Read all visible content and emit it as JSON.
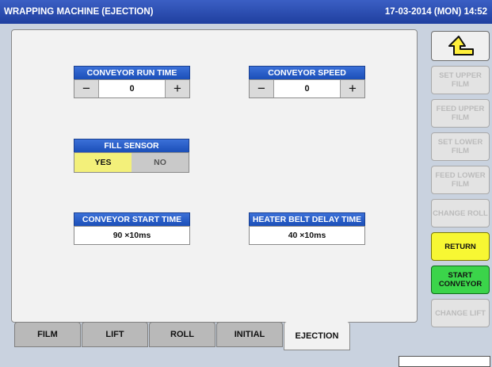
{
  "header": {
    "title": "WRAPPING MACHINE (EJECTION)",
    "datetime": "17-03-2014 (MON) 14:52"
  },
  "widgets": {
    "conveyor_run_time": {
      "label": "CONVEYOR RUN TIME",
      "value": "0",
      "minus": "−",
      "plus": "+"
    },
    "conveyor_speed": {
      "label": "CONVEYOR SPEED",
      "value": "0",
      "minus": "−",
      "plus": "+"
    },
    "fill_sensor": {
      "label": "FILL SENSOR",
      "yes": "YES",
      "no": "NO",
      "selected": "YES"
    },
    "conveyor_start_time": {
      "label": "CONVEYOR START TIME",
      "value": "90 ×10ms"
    },
    "heater_belt_delay_time": {
      "label": "HEATER BELT DELAY TIME",
      "value": "40 ×10ms"
    }
  },
  "tabs": [
    "FILM",
    "LIFT",
    "ROLL",
    "INITIAL",
    "EJECTION"
  ],
  "active_tab": "EJECTION",
  "sidebar": {
    "back_icon": "return-arrow-icon",
    "set_upper_film": "SET UPPER FILM",
    "feed_upper_film": "FEED UPPER FILM",
    "set_lower_film": "SET LOWER FILM",
    "feed_lower_film": "FEED LOWER FILM",
    "change_roll": "CHANGE ROLL",
    "return": "RETURN",
    "start_conveyor": "START CONVEYOR",
    "change_lift": "CHANGE LIFT"
  },
  "colors": {
    "title_bar": "#2a4fb5",
    "widget_header": "#2a5fc8",
    "return_button": "#f7f733",
    "start_conveyor_button": "#3bd44a",
    "selected_toggle": "#f3f07a"
  }
}
